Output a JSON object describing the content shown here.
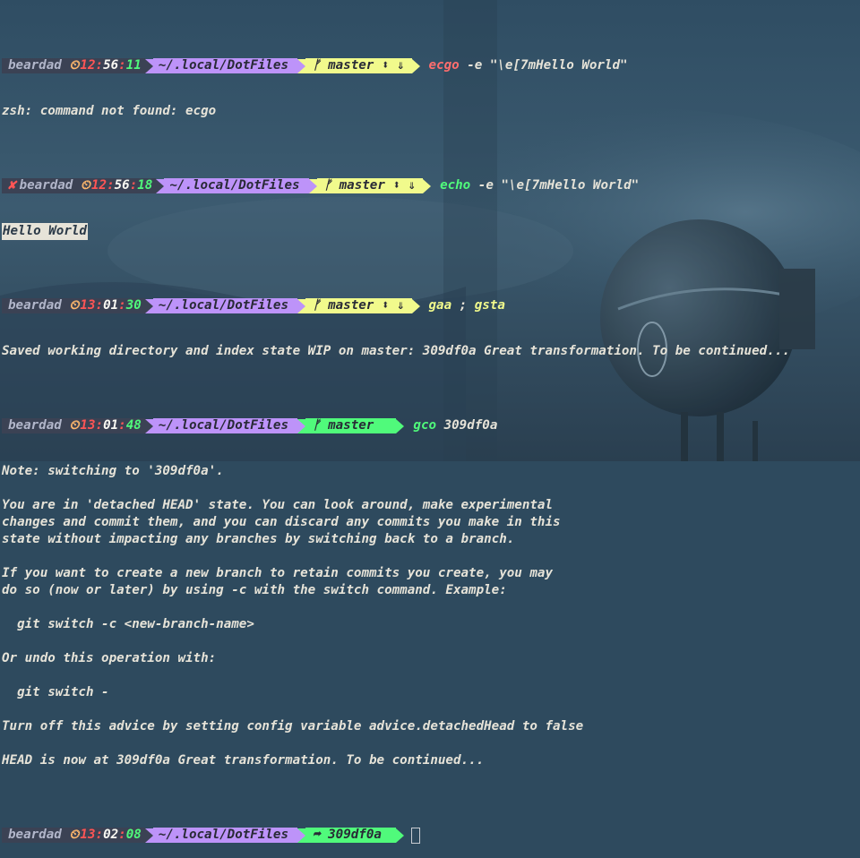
{
  "theme": {
    "bg": "#2e4a5e",
    "fg": "#e6e3d8",
    "user_bg": "#3b4254",
    "dir_bg": "#bd93f9",
    "git_yellow": "#f1fa8c",
    "git_green": "#50fa7b",
    "err": "#ff5555"
  },
  "icons": {
    "clock": "clock-icon",
    "branch": "git-branch-icon",
    "updown": "up-down-icon",
    "stash": "stash-arrow-icon",
    "error": "error-x-icon",
    "detached": "detached-arrow-icon"
  },
  "prompts": [
    {
      "user": "beardad",
      "hh": "12",
      "mm": "56",
      "ss": "11",
      "dir": "~/.local/DotFiles",
      "branch": "master",
      "cmd_name": "ecgo",
      "cmd_args": " -e \"\\e[7mHello World\""
    },
    {
      "user": "beardad",
      "hh": "12",
      "mm": "56",
      "ss": "18",
      "dir": "~/.local/DotFiles",
      "branch": "master",
      "cmd_name": "echo",
      "cmd_args": " -e \"\\e[7mHello World\""
    },
    {
      "user": "beardad",
      "hh": "13",
      "mm": "01",
      "ss": "30",
      "dir": "~/.local/DotFiles",
      "branch": "master",
      "cmd_name": "gaa",
      "cmd_args": " ; ",
      "cmd_name2": "gsta"
    },
    {
      "user": "beardad",
      "hh": "13",
      "mm": "01",
      "ss": "48",
      "dir": "~/.local/DotFiles",
      "branch": "master",
      "cmd_name": "gco",
      "cmd_args": " 309df0a"
    },
    {
      "user": "beardad",
      "hh": "13",
      "mm": "02",
      "ss": "08",
      "dir": "~/.local/DotFiles",
      "branch": "309df0a"
    }
  ],
  "output": {
    "o1": "zsh: command not found: ecgo",
    "o2": "Hello World",
    "o3": "Saved working directory and index state WIP on master: 309df0a Great transformation. To be continued...",
    "o4": [
      "Note: switching to '309df0a'.",
      "",
      "You are in 'detached HEAD' state. You can look around, make experimental",
      "changes and commit them, and you can discard any commits you make in this",
      "state without impacting any branches by switching back to a branch.",
      "",
      "If you want to create a new branch to retain commits you create, you may",
      "do so (now or later) by using -c with the switch command. Example:",
      "",
      "  git switch -c <new-branch-name>",
      "",
      "Or undo this operation with:",
      "",
      "  git switch -",
      "",
      "Turn off this advice by setting config variable advice.detachedHead to false",
      "",
      "HEAD is now at 309df0a Great transformation. To be continued..."
    ]
  }
}
